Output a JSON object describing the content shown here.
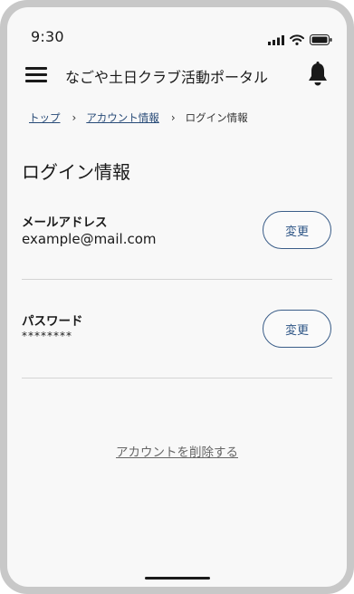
{
  "status_bar": {
    "time": "9:30"
  },
  "header": {
    "title": "なごや土日クラブ活動ポータル"
  },
  "breadcrumb": [
    {
      "label": "トップ",
      "link": true
    },
    {
      "label": "アカウント情報",
      "link": true
    },
    {
      "label": "ログイン情報",
      "link": false
    }
  ],
  "breadcrumb_separator": "›",
  "page": {
    "title": "ログイン情報"
  },
  "fields": [
    {
      "label": "メールアドレス",
      "value": "example@mail.com",
      "button": "変更"
    },
    {
      "label": "パスワード",
      "value": "********",
      "button": "変更"
    }
  ],
  "delete_account": {
    "label": "アカウントを削除する"
  },
  "colors": {
    "accent": "#2f5687",
    "link": "#274a77",
    "screen_bg": "#f8f8f8",
    "frame": "#c8c8c8"
  }
}
